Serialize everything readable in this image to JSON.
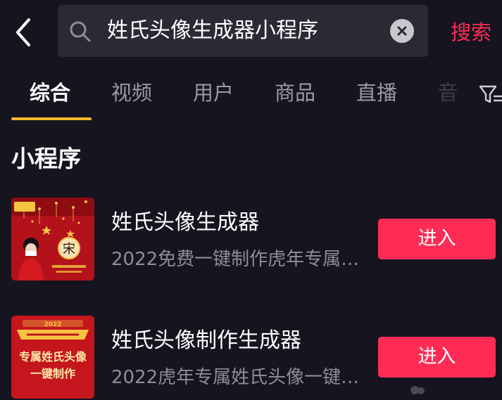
{
  "header": {
    "search_query": "姓氏头像生成器小程序",
    "search_button": "搜索"
  },
  "tabs": [
    {
      "label": "综合",
      "active": true
    },
    {
      "label": "视频",
      "active": false
    },
    {
      "label": "用户",
      "active": false
    },
    {
      "label": "商品",
      "active": false
    },
    {
      "label": "直播",
      "active": false
    },
    {
      "label": "音",
      "active": false
    }
  ],
  "section": {
    "title": "小程序"
  },
  "results": [
    {
      "title": "姓氏头像生成器",
      "description": "2022免费一键制作虎年专属…",
      "button": "进入",
      "thumbnail": {
        "surname_char": "宋"
      }
    },
    {
      "title": "姓氏头像制作生成器",
      "description": "2022虎年专属姓氏头像一键…",
      "button": "进入",
      "thumbnail": {
        "top_text": "2022",
        "line1": "专属姓氏头像",
        "line2": "一键制作"
      }
    }
  ],
  "colors": {
    "background": "#15141f",
    "accent": "#fe2c55",
    "tab_indicator": "#f9b82d",
    "search_box": "#2a2a35"
  },
  "icons": [
    "back-arrow-icon",
    "search-icon",
    "clear-icon",
    "filter-icon"
  ]
}
